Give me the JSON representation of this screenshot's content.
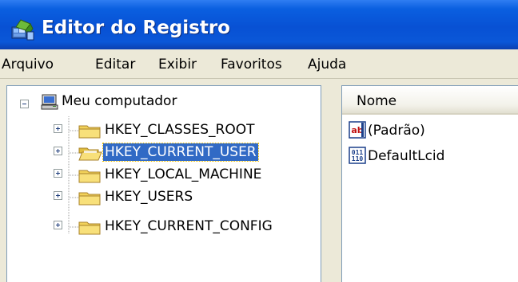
{
  "window": {
    "title": "Editor do Registro",
    "icon": "regedit-icon"
  },
  "menu": {
    "items": [
      "Arquivo",
      "Editar",
      "Exibir",
      "Favoritos",
      "Ajuda"
    ]
  },
  "tree": {
    "root_label": "Meu computador",
    "root_icon": "computer-icon",
    "root_expanded": true,
    "children": [
      {
        "label": "HKEY_CLASSES_ROOT",
        "selected": false,
        "icon": "folder-icon"
      },
      {
        "label": "HKEY_CURRENT_USER",
        "selected": true,
        "icon": "open-folder-icon"
      },
      {
        "label": "HKEY_LOCAL_MACHINE",
        "selected": false,
        "icon": "folder-icon"
      },
      {
        "label": "HKEY_USERS",
        "selected": false,
        "icon": "folder-icon"
      },
      {
        "label": "HKEY_CURRENT_CONFIG",
        "selected": false,
        "icon": "folder-icon"
      }
    ]
  },
  "list": {
    "column_header": "Nome",
    "rows": [
      {
        "name": "(Padrão)",
        "icon": "string-value-icon"
      },
      {
        "name": "DefaultLcid",
        "icon": "binary-value-icon"
      }
    ]
  },
  "colors": {
    "titlebar": "#0851d4",
    "selection": "#316ac5",
    "folder": "#f2d25a",
    "chrome": "#ece9d8"
  }
}
